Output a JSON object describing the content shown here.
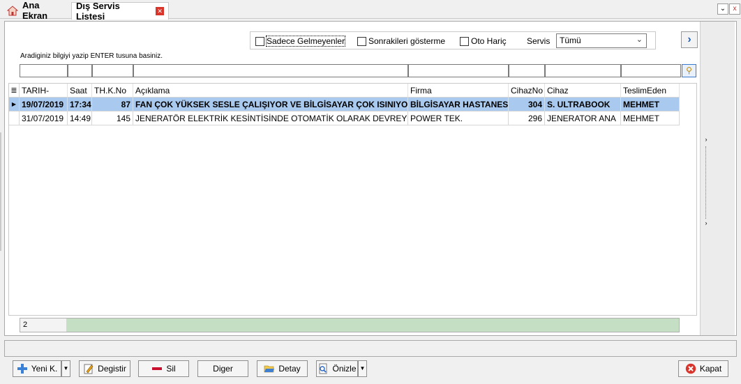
{
  "tabs": [
    {
      "label": "Ana Ekran",
      "icon": "home-icon"
    },
    {
      "label": "Dış Servis Listesi",
      "icon": "close-icon",
      "active": true
    }
  ],
  "filters": {
    "sadece_gelmeyenler": {
      "label": "Sadece Gelmeyenler",
      "checked": false
    },
    "sonrakileri_gosterme": {
      "label": "Sonrakileri gösterme",
      "checked": false
    },
    "oto_haric": {
      "label": "Oto Hariç",
      "checked": false
    },
    "servis_label": "Servis",
    "servis_value": "Tümü"
  },
  "hint": "Aradiginiz bilgiyi yazip ENTER tusuna basiniz.",
  "grid": {
    "columns": [
      "TARIH-",
      "Saat",
      "TH.K.No",
      "Açıklama",
      "Firma",
      "CihazNo",
      "Cihaz",
      "TeslimEden"
    ],
    "rows": [
      [
        "19/07/2019",
        "17:34",
        "87",
        "FAN ÇOK YÜKSEK SESLE ÇALIŞIYOR VE BİLGİSAYAR ÇOK ISINIYOR",
        "BİLGİSAYAR HASTANESİ",
        "304",
        "S. ULTRABOOK",
        "MEHMET"
      ],
      [
        "31/07/2019",
        "14:49",
        "145",
        "JENERATÖR ELEKTRİK KESİNTİSİNDE OTOMATİK OLARAK DEVREYE",
        "POWER TEK.",
        "296",
        "JENERATOR ANA",
        "MEHMET"
      ]
    ],
    "selected_row": 0,
    "row_count": "2"
  },
  "buttons": {
    "yeni": "Yeni K.",
    "degistir": "Degistir",
    "sil": "Sil",
    "diger": "Diger",
    "detay": "Detay",
    "onizle": "Önizle",
    "kapat": "Kapat"
  },
  "colors": {
    "selection": "#a9c9ee",
    "count_bar": "#c4dfc4",
    "accent": "#1f5fb8"
  }
}
